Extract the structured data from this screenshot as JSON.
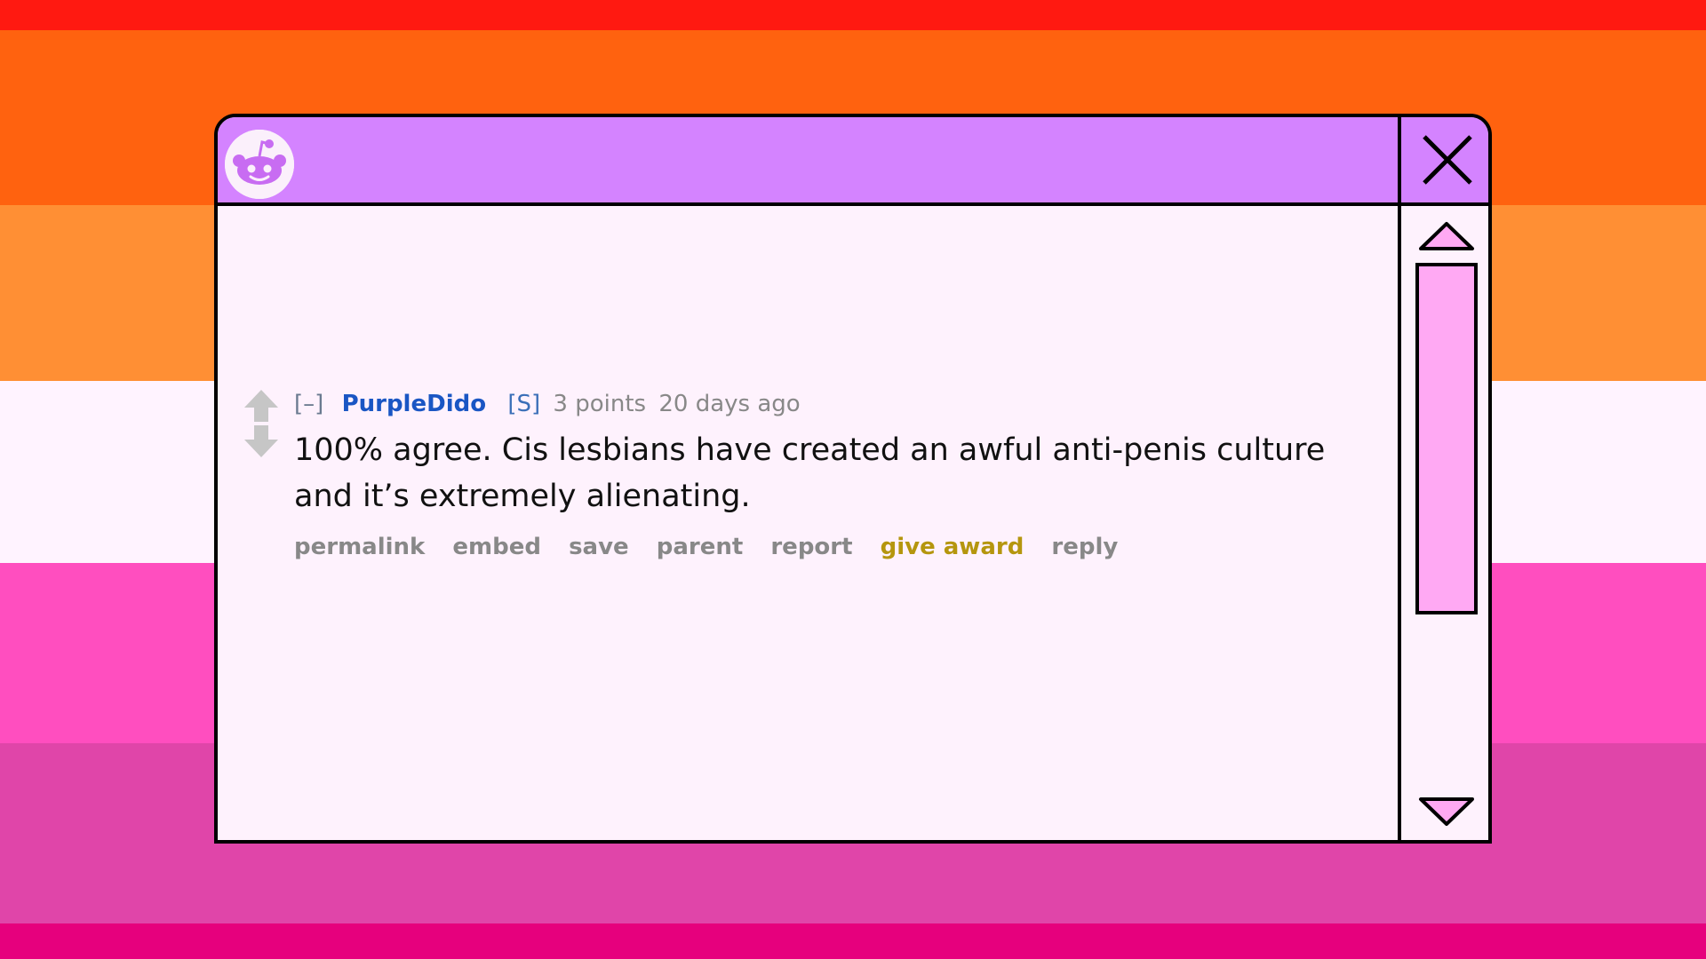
{
  "background": {
    "flag_stripes": [
      "#ff1911",
      "#ff620f",
      "#ff8f34",
      "#fff3ff",
      "#ff4ebf",
      "#e045a9",
      "#e6007d"
    ]
  },
  "window": {
    "titlebar_color": "#d483ff",
    "logo_icon": "reddit-snoo-icon",
    "close_icon": "close-x-icon",
    "scroll_up_icon": "triangle-up-icon",
    "scroll_down_icon": "triangle-down-icon",
    "scroll_thumb_color": "#ffa9f3"
  },
  "comment": {
    "collapse_label": "[–]",
    "author": "PurpleDido",
    "submitter_tag": "[S]",
    "score": "3 points",
    "age": "20 days ago",
    "upvote_icon": "upvote-arrow-icon",
    "downvote_icon": "downvote-arrow-icon",
    "text": "100% agree. Cis lesbians have created an awful anti-penis culture and it’s extremely alienating.",
    "actions": {
      "permalink": "permalink",
      "embed": "embed",
      "save": "save",
      "parent": "parent",
      "report": "report",
      "give_award": "give award",
      "reply": "reply"
    }
  }
}
